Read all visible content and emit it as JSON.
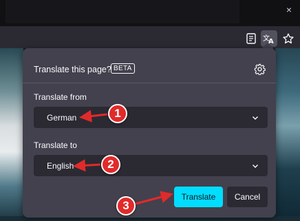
{
  "browser": {
    "close_glyph": "×",
    "toolbar_icons": [
      "reader-view-icon",
      "translate-icon",
      "bookmark-star-icon"
    ]
  },
  "panel": {
    "title": "Translate this page?",
    "beta_badge": "BETA",
    "from_label": "Translate from",
    "from_value": "German",
    "to_label": "Translate to",
    "to_value": "English",
    "translate_button": "Translate",
    "cancel_button": "Cancel"
  },
  "annotations": {
    "step1": "1",
    "step2": "2",
    "step3": "3"
  },
  "colors": {
    "panel_bg": "#42414d",
    "select_bg": "#2b2a33",
    "primary_button": "#00ddff",
    "marker_red": "#e22a2a"
  }
}
